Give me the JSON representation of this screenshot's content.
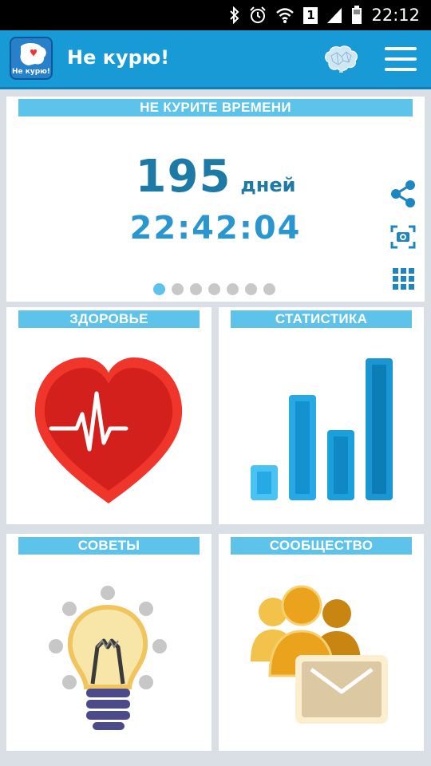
{
  "status_bar": {
    "time": "22:12",
    "sim_label": "1"
  },
  "app_bar": {
    "logo_text": "Не курю!",
    "title": "Не курю!"
  },
  "timer": {
    "header": "НЕ КУРИТЕ ВРЕМЕНИ",
    "days_value": "195",
    "days_label": "дней",
    "clock": "22:42:04",
    "page_count": 7,
    "active_page": 1
  },
  "tiles": {
    "health": "ЗДОРОВЬЕ",
    "stats": "СТАТИСТИКА",
    "tips": "СОВЕТЫ",
    "community": "СООБЩЕСТВО"
  },
  "colors": {
    "app_bar": "#189ad6",
    "header_strip": "#5ec3ea",
    "primary_text": "#1d7aa6",
    "heart": "#d8261f",
    "bars": "#26a9e5",
    "people": "#eba21d",
    "envelope": "#dfcca5"
  },
  "icons": [
    "bluetooth-icon",
    "alarm-icon",
    "wifi-icon",
    "signal-icon",
    "battery-icon",
    "brain-icon",
    "menu-icon",
    "share-icon",
    "screenshot-icon",
    "grid-icon",
    "heart-icon",
    "bar-chart-icon",
    "lightbulb-icon",
    "community-icon"
  ]
}
